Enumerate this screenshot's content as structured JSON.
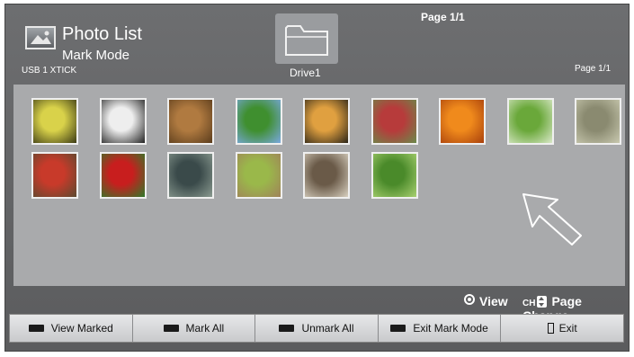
{
  "header": {
    "title": "Photo List",
    "mode": "Mark Mode",
    "device": "USB 1 XTICK",
    "folder_label": "Drive1",
    "page_top": "Page 1/1",
    "page_right": "Page 1/1"
  },
  "thumbnails": [
    {
      "name": "butterfly-photo",
      "colors": [
        "#d9d24a",
        "#3b3a14"
      ]
    },
    {
      "name": "horse-riders-photo",
      "colors": [
        "#eeeeee",
        "#222222"
      ]
    },
    {
      "name": "corridor-photo",
      "colors": [
        "#b07a40",
        "#5a3c1c"
      ]
    },
    {
      "name": "blue-flower-photo",
      "colors": [
        "#3f8f2f",
        "#7aa8e0"
      ]
    },
    {
      "name": "sunset-photo",
      "colors": [
        "#e0a040",
        "#2a2418"
      ]
    },
    {
      "name": "red-tree-photo",
      "colors": [
        "#b73b3b",
        "#6a8a4a"
      ]
    },
    {
      "name": "oranges-photo",
      "colors": [
        "#f08a1c",
        "#a8400c"
      ]
    },
    {
      "name": "dandelion-photo",
      "colors": [
        "#6aa83a",
        "#d9e8c8"
      ]
    },
    {
      "name": "pots-photo",
      "colors": [
        "#8a8a70",
        "#c9c9b0"
      ]
    },
    {
      "name": "berries-photo",
      "colors": [
        "#c83a2a",
        "#5a4a30"
      ]
    },
    {
      "name": "red-rose-photo",
      "colors": [
        "#c81e1e",
        "#2f7a2a"
      ]
    },
    {
      "name": "bowl-photo",
      "colors": [
        "#3a4a4a",
        "#8a9a90"
      ]
    },
    {
      "name": "garden-path-photo",
      "colors": [
        "#9ab84a",
        "#a0825a"
      ]
    },
    {
      "name": "hallway-photo",
      "colors": [
        "#6a5a48",
        "#d8d0c0"
      ]
    },
    {
      "name": "bamboo-photo",
      "colors": [
        "#4a8a2a",
        "#a8d070"
      ]
    }
  ],
  "hints": {
    "view": "View",
    "ch": "CH",
    "page_change": "Page Change"
  },
  "buttons": [
    {
      "label": "View Marked"
    },
    {
      "label": "Mark All"
    },
    {
      "label": "Unmark All"
    },
    {
      "label": "Exit Mark Mode"
    },
    {
      "label": "Exit"
    }
  ]
}
